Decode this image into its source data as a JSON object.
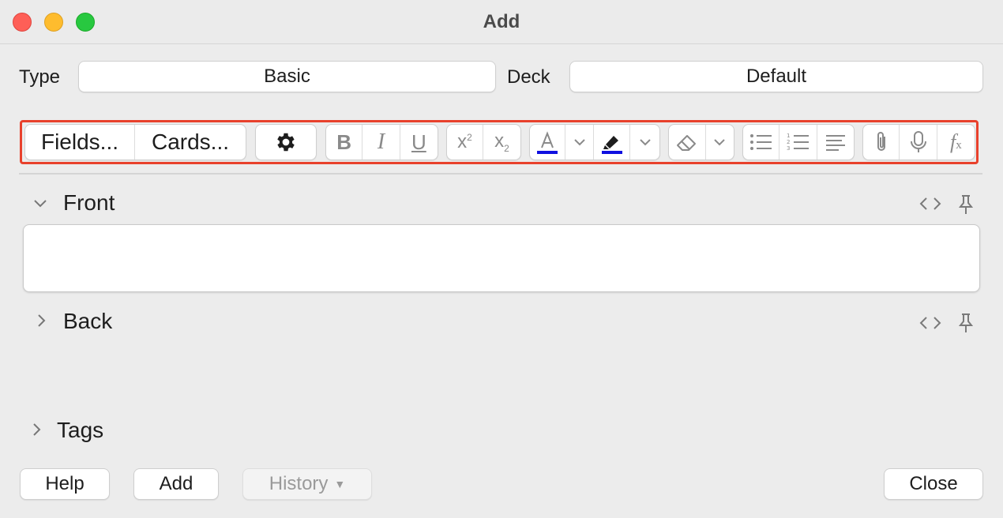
{
  "window": {
    "title": "Add"
  },
  "top_row": {
    "type_label": "Type",
    "type_value": "Basic",
    "deck_label": "Deck",
    "deck_value": "Default"
  },
  "toolbar": {
    "fields_label": "Fields...",
    "cards_label": "Cards...",
    "text_color": "#1010e0",
    "highlight_color": "#1010e0"
  },
  "fields": [
    {
      "name": "Front",
      "expanded": true,
      "value": ""
    },
    {
      "name": "Back",
      "expanded": false
    }
  ],
  "tags": {
    "label": "Tags"
  },
  "bottom": {
    "help_label": "Help",
    "add_label": "Add",
    "history_label": "History",
    "close_label": "Close"
  },
  "icons": [
    "gear-icon",
    "bold-icon",
    "italic-icon",
    "underline-icon",
    "superscript-icon",
    "subscript-icon",
    "text-color-icon",
    "chevron-down-icon",
    "highlight-icon",
    "eraser-icon",
    "bullet-list-icon",
    "numbered-list-icon",
    "align-icon",
    "paperclip-icon",
    "microphone-icon",
    "function-icon",
    "html-editor-icon",
    "pin-icon"
  ]
}
